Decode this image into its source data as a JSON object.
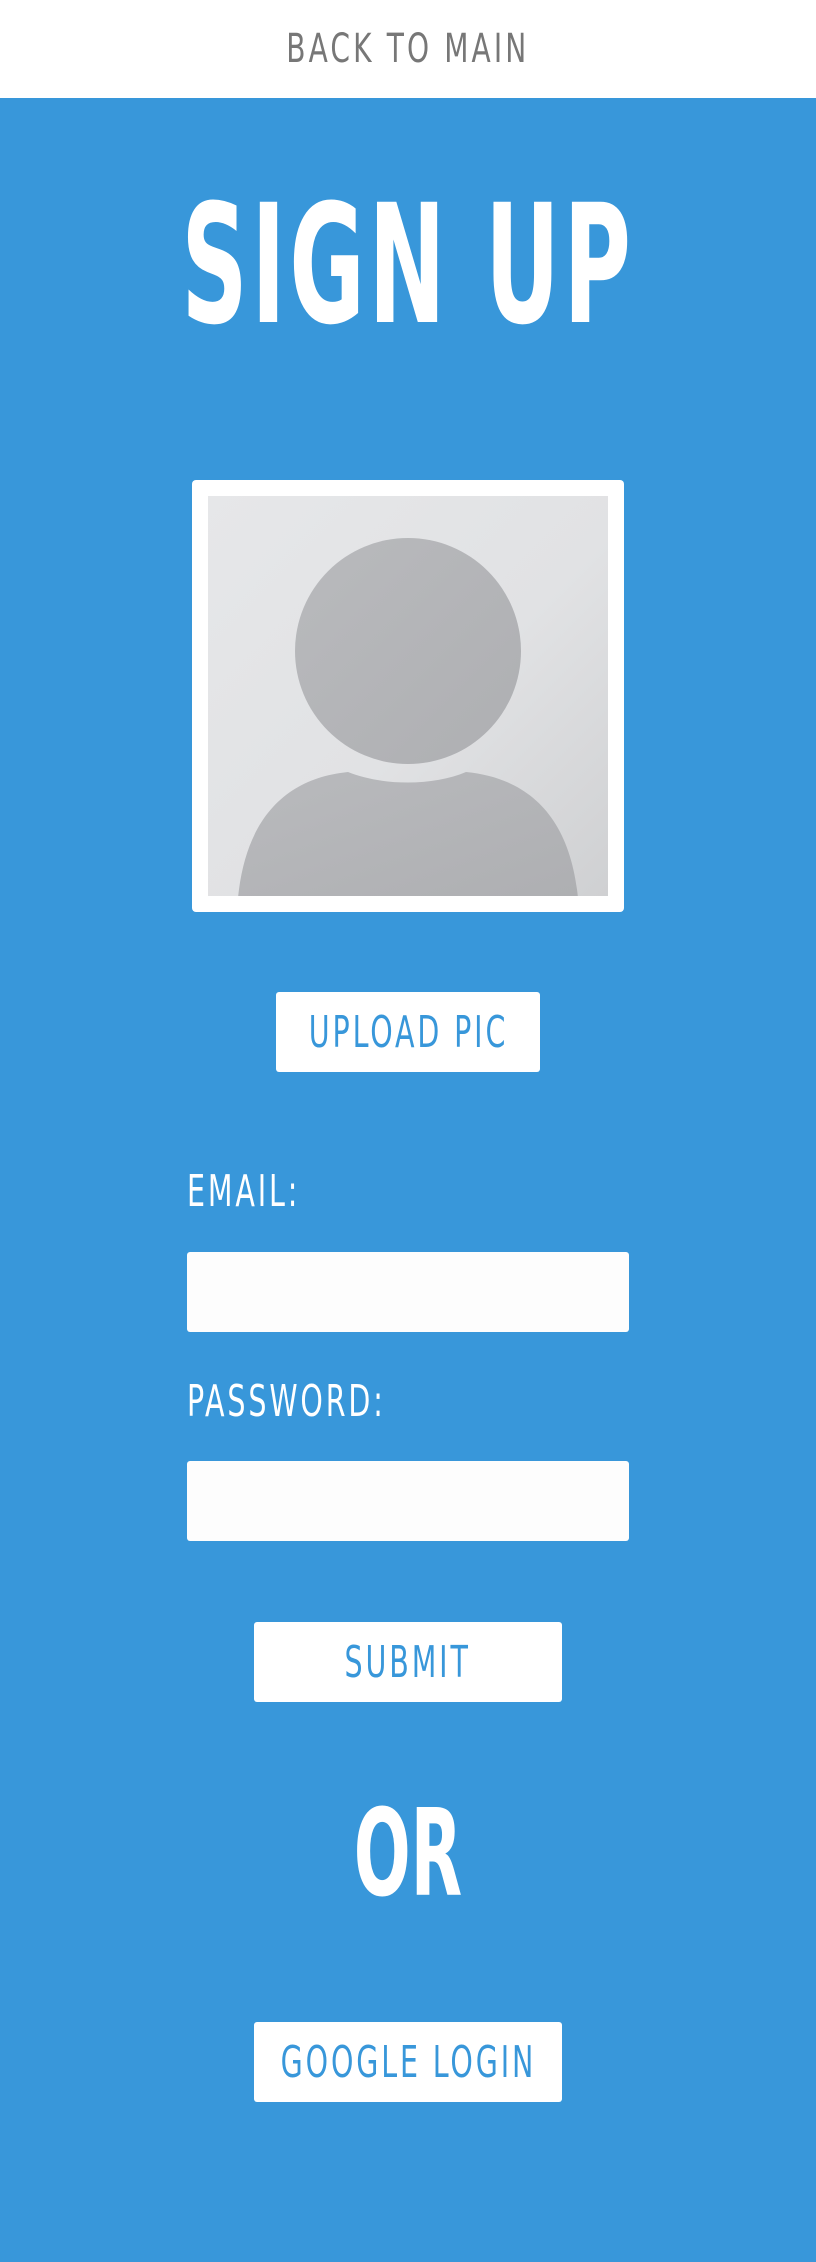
{
  "nav": {
    "back_label": "BACK TO MAIN"
  },
  "page": {
    "title": "SIGN UP"
  },
  "avatar": {
    "icon": "default-user-avatar-icon",
    "upload_label": "UPLOAD PIC"
  },
  "form": {
    "email_label": "EMAIL:",
    "email_value": "",
    "password_label": "PASSWORD:",
    "password_value": "",
    "submit_label": "SUBMIT"
  },
  "divider": {
    "or_label": "OR"
  },
  "social": {
    "google_label": "GOOGLE LOGIN"
  },
  "colors": {
    "background": "#3897da",
    "accent_text": "#3897da",
    "nav_text": "#777777",
    "surface": "#ffffff",
    "avatar_silhouette": "#b5b6b9"
  }
}
